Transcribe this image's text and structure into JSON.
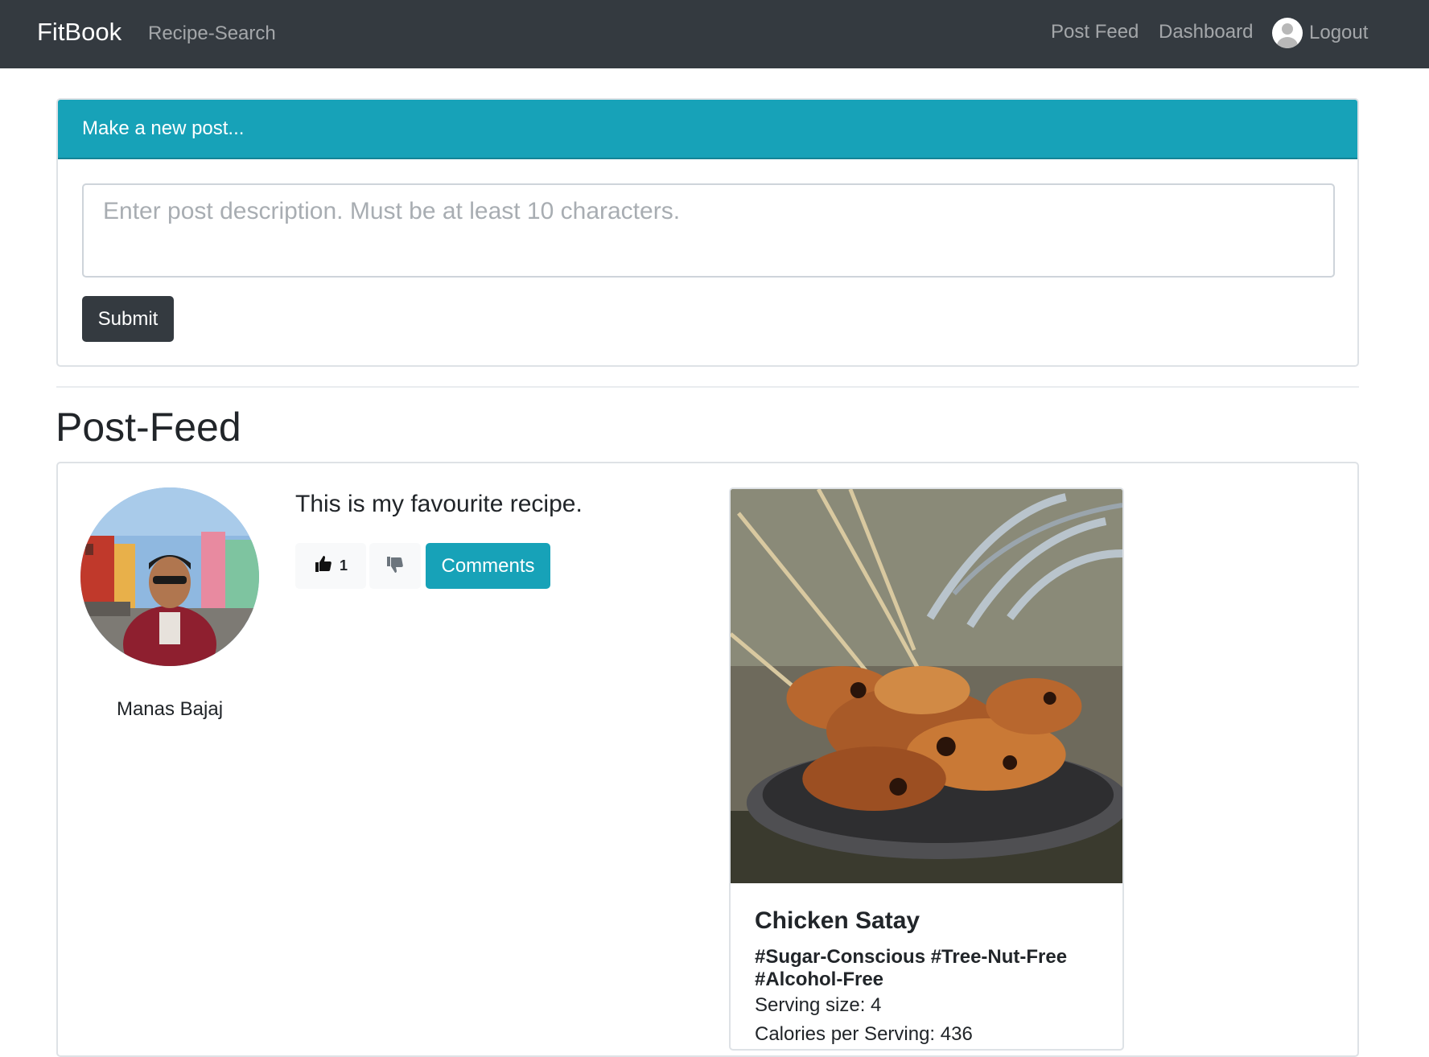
{
  "navbar": {
    "brand": "FitBook",
    "links": {
      "recipe_search": "Recipe-Search",
      "post_feed": "Post Feed",
      "dashboard": "Dashboard",
      "logout": "Logout"
    }
  },
  "new_post": {
    "header": "Make a new post...",
    "textarea_placeholder": "Enter post description. Must be at least 10 characters.",
    "submit_label": "Submit"
  },
  "feed": {
    "title": "Post-Feed",
    "posts": [
      {
        "author": "Manas Bajaj",
        "text": "This is my favourite recipe.",
        "likes": "1",
        "comments_label": "Comments",
        "recipe": {
          "title": "Chicken Satay",
          "tags": "#Sugar-Conscious #Tree-Nut-Free #Alcohol-Free",
          "serving": "Serving size: 4",
          "calories": "Calories per Serving: 436"
        }
      }
    ]
  },
  "colors": {
    "navbar_bg": "#343a40",
    "info": "#17a2b8",
    "dark_button": "#343a40"
  },
  "icons": [
    "user-avatar-icon",
    "thumbs-up-icon",
    "thumbs-down-icon"
  ]
}
